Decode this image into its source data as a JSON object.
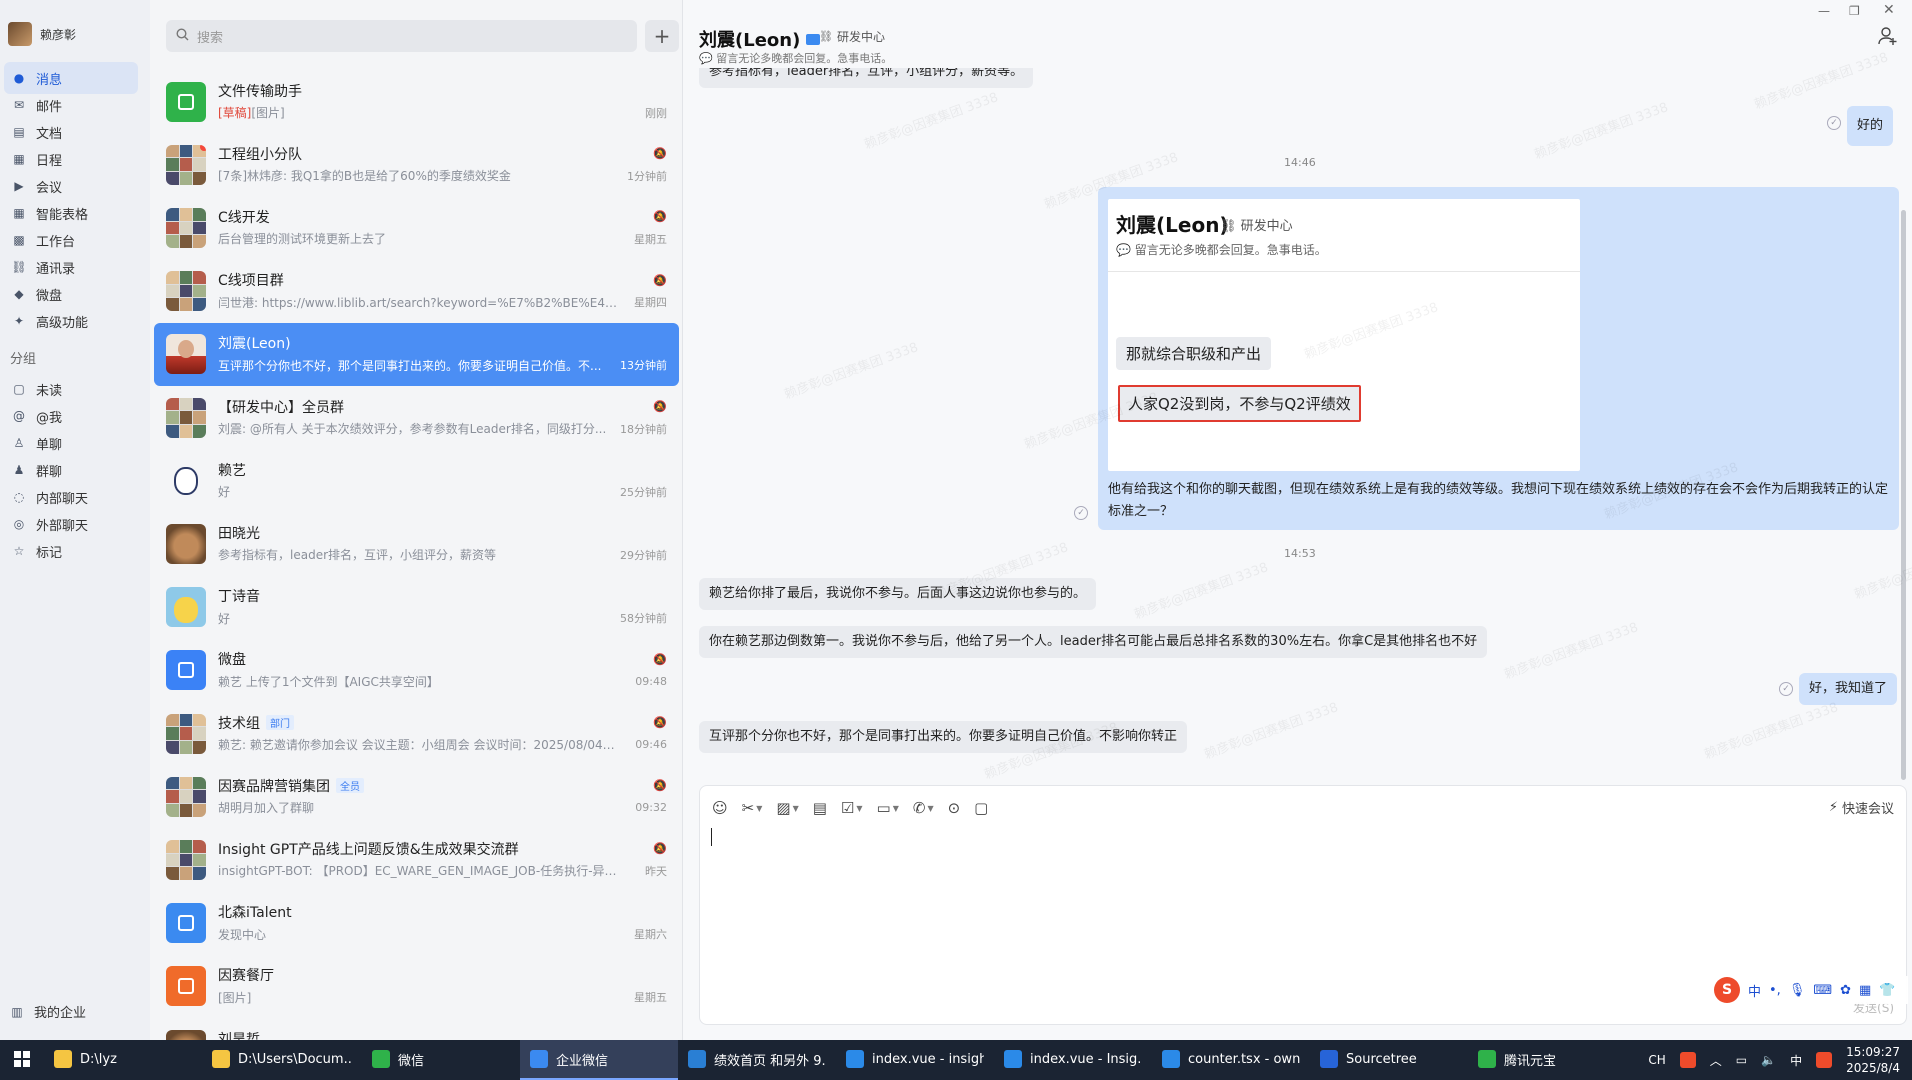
{
  "nav": {
    "user_name": "赖彦彰",
    "items": [
      {
        "label": "消息",
        "icon": "message-icon",
        "active": true
      },
      {
        "label": "邮件",
        "icon": "mail-icon"
      },
      {
        "label": "文档",
        "icon": "document-icon"
      },
      {
        "label": "日程",
        "icon": "calendar-icon"
      },
      {
        "label": "会议",
        "icon": "meeting-icon"
      },
      {
        "label": "智能表格",
        "icon": "smart-table-icon"
      },
      {
        "label": "工作台",
        "icon": "workbench-icon"
      },
      {
        "label": "通讯录",
        "icon": "contacts-icon"
      },
      {
        "label": "微盘",
        "icon": "drive-icon"
      },
      {
        "label": "高级功能",
        "icon": "advanced-icon"
      }
    ],
    "group_title": "分组",
    "groups": [
      {
        "label": "未读",
        "icon": "unread-icon"
      },
      {
        "label": "@我",
        "icon": "at-icon"
      },
      {
        "label": "单聊",
        "icon": "single-chat-icon"
      },
      {
        "label": "群聊",
        "icon": "group-chat-icon"
      },
      {
        "label": "内部聊天",
        "icon": "internal-chat-icon"
      },
      {
        "label": "外部聊天",
        "icon": "external-chat-icon"
      },
      {
        "label": "标记",
        "icon": "star-icon"
      }
    ],
    "bottom_label": "我的企业"
  },
  "search": {
    "placeholder": "搜索"
  },
  "conversations": [
    {
      "name": "文件传输助手",
      "draft": "[草稿]",
      "msg": "[图片]",
      "time": "刚刚",
      "muted": false,
      "avatar": "#2fb24a"
    },
    {
      "name": "工程组小分队",
      "msg": "[7条]林炜彦: 我Q1拿的B也是给了60%的季度绩效奖金",
      "time": "1分钟前",
      "muted": true,
      "avatar": "mosaic",
      "dot": true
    },
    {
      "name": "C线开发",
      "msg": "后台管理的测试环境更新上去了",
      "time": "星期五",
      "muted": true,
      "avatar": "mosaic"
    },
    {
      "name": "C线项目群",
      "msg": "闫世港: https://www.liblib.art/search?keyword=%E7%B2%BE%E4%BF...",
      "time": "星期四",
      "muted": true,
      "avatar": "mosaic"
    },
    {
      "name": "刘震(Leon)",
      "msg": "互评那个分你也不好，那个是同事打出来的。你要多证明自己价值。不...",
      "time": "13分钟前",
      "muted": false,
      "avatar": "person",
      "active": true
    },
    {
      "name": "【研发中心】全员群",
      "msg": "刘震: @所有人 关于本次绩效评分，参考参数有Leader排名，同级打分...",
      "time": "18分钟前",
      "muted": true,
      "avatar": "mosaic"
    },
    {
      "name": "赖艺",
      "msg": "好",
      "time": "25分钟前",
      "muted": false,
      "avatar": "cartoon"
    },
    {
      "name": "田晓光",
      "msg": "参考指标有，leader排名，互评，小组评分，薪资等",
      "time": "29分钟前",
      "muted": false,
      "avatar": "dog"
    },
    {
      "name": "丁诗音",
      "msg": "好",
      "time": "58分钟前",
      "muted": false,
      "avatar": "cartoon2"
    },
    {
      "name": "微盘",
      "msg": "赖艺 上传了1个文件到【AIGC共享空间】",
      "time": "09:48",
      "muted": true,
      "avatar": "#3b82f6"
    },
    {
      "name": "技术组",
      "tag": "部门",
      "msg": "赖艺: 赖艺邀请你参加会议 会议主题：小组周会 会议时间：2025/08/04 10...",
      "time": "09:46",
      "muted": true,
      "avatar": "mosaic"
    },
    {
      "name": "因赛品牌营销集团",
      "tag": "全员",
      "msg": "胡明月加入了群聊",
      "time": "09:32",
      "muted": true,
      "avatar": "mosaic"
    },
    {
      "name": "Insight GPT产品线上问题反馈&生成效果交流群",
      "msg": "insightGPT-BOT: 【PROD】EC_WARE_GEN_IMAGE_JOB-任务执行-异常[C...",
      "time": "昨天",
      "muted": true,
      "avatar": "mosaic"
    },
    {
      "name": "北森iTalent",
      "msg": "发现中心",
      "time": "星期六",
      "muted": false,
      "avatar": "#3b8af0"
    },
    {
      "name": "因赛餐厅",
      "msg": "[图片]",
      "time": "星期五",
      "muted": false,
      "avatar": "#f06b2a"
    },
    {
      "name": "刘昊哲",
      "msg": "",
      "time": "",
      "muted": false,
      "avatar": "dog"
    }
  ],
  "chat": {
    "name": "刘震(Leon)",
    "dept": "研发中心",
    "signature": "留言无论多晚都会回复。急事电话。",
    "top_cut": "参考指标有，leader排名，互评，小组评分，薪资等。",
    "msg_ok": "好的",
    "time1": "14:46",
    "card": {
      "name": "刘震(Leon)",
      "dept": "研发中心",
      "signature": "留言无论多晚都会回复。急事电话。",
      "b1": "那就综合职级和产出",
      "b2": "人家Q2没到岗，不参与Q2评绩效",
      "text": "他有给我这个和你的聊天截图，但现在绩效系统上是有我的绩效等级。我想问下现在绩效系统上绩效的存在会不会作为后期我转正的认定标准之一？"
    },
    "time2": "14:53",
    "m1": "赖艺给你排了最后，我说你不参与。后面人事这边说你也参与的。",
    "m2": "你在赖艺那边倒数第一。我说你不参与后，他给了另一个人。leader排名可能占最后总排名系数的30%左右。你拿C是其他排名也不好",
    "m3": "好，我知道了",
    "m4": "互评那个分你也不好，那个是同事打出来的。你要多证明自己价值。不影响你转正"
  },
  "input": {
    "quick_meeting": "快速会议",
    "send_hint": "发送(S)"
  },
  "ime": {
    "lang": "中"
  },
  "watermark": "赖彦彰@因赛集团 3338",
  "taskbar": {
    "items": [
      {
        "label": "D:\\lyz",
        "color": "#f5c542"
      },
      {
        "label": "D:\\Users\\Docum...",
        "color": "#f5c542"
      },
      {
        "label": "微信",
        "color": "#2fb24a"
      },
      {
        "label": "企业微信",
        "color": "#3b8af0",
        "active": true
      },
      {
        "label": "绩效首页 和另外 9...",
        "color": "#2a7fd4"
      },
      {
        "label": "index.vue - insigh...",
        "color": "#2b8ae8"
      },
      {
        "label": "index.vue - Insig...",
        "color": "#2b8ae8"
      },
      {
        "label": "counter.tsx - own...",
        "color": "#2b8ae8"
      },
      {
        "label": "Sourcetree",
        "color": "#2764d8"
      },
      {
        "label": "腾讯元宝",
        "color": "#2fb24a"
      }
    ],
    "tray_lang": "CH",
    "tray_ime": "中",
    "time": "15:09:27",
    "date": "2025/8/4"
  }
}
